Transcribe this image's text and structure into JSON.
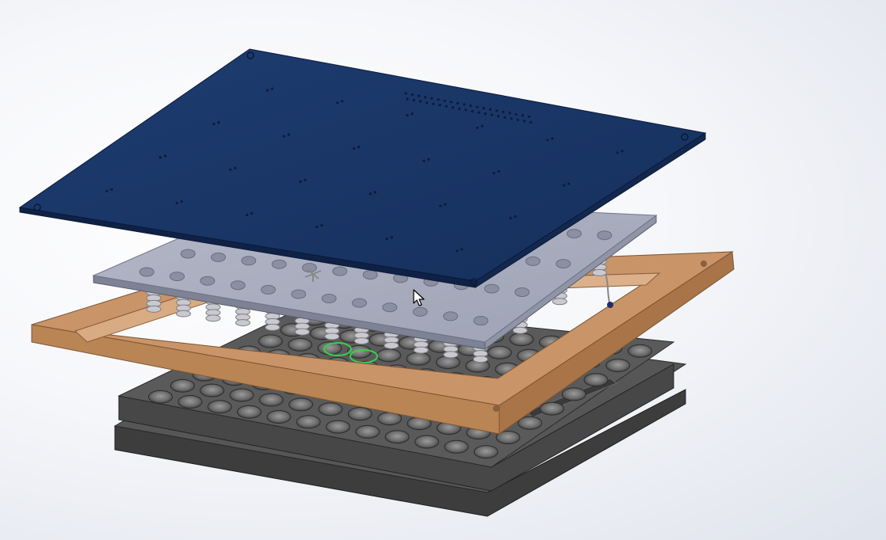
{
  "viewport": {
    "background_top": "#ffffff",
    "background_edge": "#dfe3ec"
  },
  "assembly": {
    "pcb": {
      "name": "pcb-board",
      "color": "#1b3766",
      "edge_color": "#0f2245"
    },
    "spacer_plate": {
      "name": "spacer-plate",
      "color": "#a6abbd",
      "edge_color": "#7b8092"
    },
    "frame": {
      "name": "frame-holder",
      "color": "#c8946a",
      "edge_color": "#8a5f3c"
    },
    "well_plate": {
      "name": "well-plate",
      "color": "#505050",
      "edge_color": "#2e2e2e",
      "wells_rows": 8,
      "wells_cols": 12
    },
    "highlight_color": "#35d24a"
  },
  "cursor": {
    "icon": "arrow-cursor-icon"
  }
}
